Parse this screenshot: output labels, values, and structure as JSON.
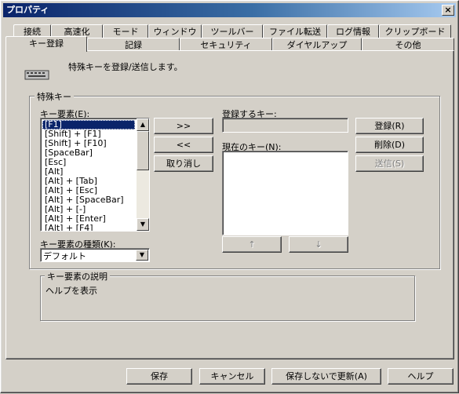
{
  "window": {
    "title": "プロパティ",
    "close_glyph": "×"
  },
  "tabs_row1": [
    "接続",
    "高速化",
    "モード",
    "ウィンドウ",
    "ツールバー",
    "ファイル転送",
    "ログ情報",
    "クリップボード"
  ],
  "tabs_row2": [
    "キー登録",
    "記録",
    "セキュリティ",
    "ダイヤルアップ",
    "その他"
  ],
  "active_tab": "キー登録",
  "intro_text": "特殊キーを登録/送信します。",
  "special_keys_group": "特殊キー",
  "key_elements_label": "キー要素(E):",
  "key_elements": [
    "[F1]",
    "[Shift] + [F1]",
    "[Shift] + [F10]",
    "[SpaceBar]",
    "[Esc]",
    "[Alt]",
    "[Alt] + [Tab]",
    "[Alt] + [Esc]",
    "[Alt] + [SpaceBar]",
    "[Alt] + [-]",
    "[Alt] + [Enter]",
    "[Alt] + [F4]"
  ],
  "selected_key_element": "[F1]",
  "add_button": ">>",
  "remove_button": "<<",
  "cancel_entry_button": "取り消し",
  "register_key_label": "登録するキー:",
  "register_key_value": "",
  "current_keys_label": "現在のキー(N):",
  "current_keys": [],
  "register_button": "登録(R)",
  "delete_button": "削除(D)",
  "send_button": "送信(S)",
  "move_up_button": "↑",
  "move_down_button": "↓",
  "key_type_label": "キー要素の種類(K):",
  "key_type_value": "デフォルト",
  "description_group": "キー要素の説明",
  "description_text": "ヘルプを表示",
  "footer": {
    "save": "保存",
    "cancel": "キャンセル",
    "update_without_save": "保存しないで更新(A)",
    "help": "ヘルプ"
  },
  "icons": {
    "scroll_up": "▲",
    "scroll_down": "▼",
    "dropdown": "▼",
    "keyboard": "keyboard-icon"
  }
}
